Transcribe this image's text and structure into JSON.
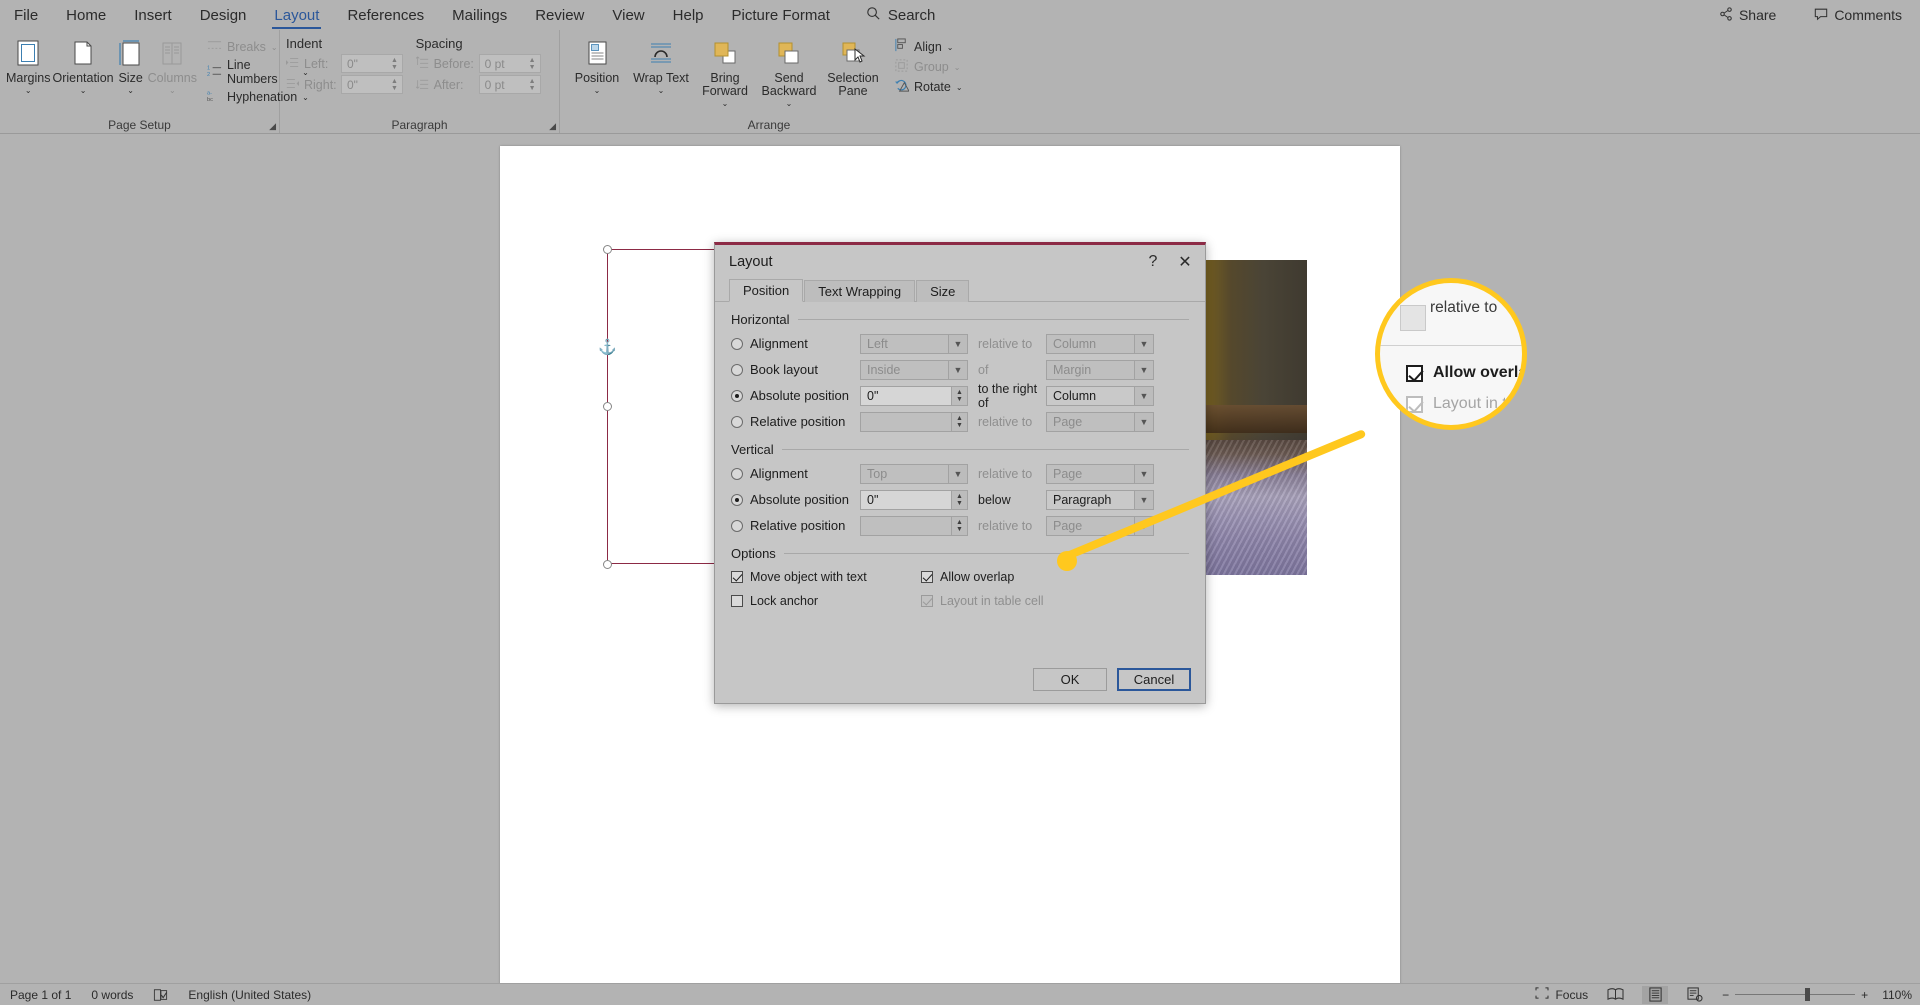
{
  "menubar": {
    "items": [
      {
        "label": "File",
        "active": false
      },
      {
        "label": "Home",
        "active": false
      },
      {
        "label": "Insert",
        "active": false
      },
      {
        "label": "Design",
        "active": false
      },
      {
        "label": "Layout",
        "active": true
      },
      {
        "label": "References",
        "active": false
      },
      {
        "label": "Mailings",
        "active": false
      },
      {
        "label": "Review",
        "active": false
      },
      {
        "label": "View",
        "active": false
      },
      {
        "label": "Help",
        "active": false
      },
      {
        "label": "Picture Format",
        "active": false
      }
    ],
    "search_label": "Search",
    "share_label": "Share",
    "comments_label": "Comments"
  },
  "ribbon": {
    "groups": [
      {
        "name": "Page Setup",
        "label": "Page Setup",
        "buttons": [
          {
            "label": "Margins",
            "caret": "⌄",
            "disabled": false
          },
          {
            "label": "Orientation",
            "caret": "⌄",
            "disabled": false
          },
          {
            "label": "Size",
            "caret": "⌄",
            "disabled": false
          },
          {
            "label": "Columns",
            "caret": "⌄",
            "disabled": true
          }
        ],
        "small_items": [
          {
            "label": "Breaks",
            "caret": "⌄",
            "disabled": true
          },
          {
            "label": "Line Numbers",
            "caret": "⌄",
            "disabled": false
          },
          {
            "label": "Hyphenation",
            "caret": "⌄",
            "disabled": false
          }
        ]
      },
      {
        "name": "Paragraph",
        "label": "Paragraph",
        "indent_label": "Indent",
        "spacing_label": "Spacing",
        "fields": [
          {
            "label": "Left:",
            "value": "0\"",
            "disabled": true
          },
          {
            "label": "Right:",
            "value": "0\"",
            "disabled": true
          },
          {
            "label": "Before:",
            "value": "0 pt",
            "disabled": true
          },
          {
            "label": "After:",
            "value": "0 pt",
            "disabled": true
          }
        ]
      },
      {
        "name": "Arrange",
        "label": "Arrange",
        "buttons": [
          {
            "label": "Position",
            "caret": "⌄",
            "disabled": false
          },
          {
            "label": "Wrap Text",
            "caret": "⌄",
            "disabled": false
          },
          {
            "label": "Bring Forward",
            "caret": "⌄",
            "disabled": false
          },
          {
            "label": "Send Backward",
            "caret": "⌄",
            "disabled": false
          },
          {
            "label": "Selection Pane",
            "caret": "",
            "disabled": false
          }
        ],
        "small_items": [
          {
            "label": "Align",
            "caret": "⌄",
            "disabled": false
          },
          {
            "label": "Group",
            "caret": "⌄",
            "disabled": true
          },
          {
            "label": "Rotate",
            "caret": "⌄",
            "disabled": false
          }
        ]
      }
    ]
  },
  "dialog": {
    "title": "Layout",
    "help_glyph": "?",
    "close_glyph": "✕",
    "tabs": [
      {
        "label": "Position",
        "active": true
      },
      {
        "label": "Text Wrapping",
        "active": false
      },
      {
        "label": "Size",
        "active": false
      }
    ],
    "horizontal": {
      "section_label": "Horizontal",
      "rows": [
        {
          "option": "Alignment",
          "option_u": "A",
          "selected": false,
          "value": "Left",
          "value_kind": "combo",
          "value_enabled": false,
          "mid": "relative to",
          "mid_u": "",
          "mid_enabled": false,
          "right": "Column",
          "right_enabled": false
        },
        {
          "option": "Book layout",
          "option_u": "B",
          "selected": false,
          "value": "Inside",
          "value_kind": "combo",
          "value_enabled": false,
          "mid": "of",
          "mid_u": "",
          "mid_enabled": false,
          "right": "Margin",
          "right_enabled": false
        },
        {
          "option": "Absolute position",
          "option_u": "s",
          "selected": true,
          "value": "0\"",
          "value_kind": "spin",
          "value_enabled": true,
          "mid": "to the right of",
          "mid_u": "t",
          "mid_enabled": true,
          "right": "Column",
          "right_enabled": true
        },
        {
          "option": "Relative position",
          "option_u": "R",
          "selected": false,
          "value": "",
          "value_kind": "spin",
          "value_enabled": false,
          "mid": "relative to",
          "mid_u": "",
          "mid_enabled": false,
          "right": "Page",
          "right_enabled": false
        }
      ]
    },
    "vertical": {
      "section_label": "Vertical",
      "rows": [
        {
          "option": "Alignment",
          "option_u": "g",
          "selected": false,
          "value": "Top",
          "value_kind": "combo",
          "value_enabled": false,
          "mid": "relative to",
          "mid_u": "",
          "mid_enabled": false,
          "right": "Page",
          "right_enabled": false
        },
        {
          "option": "Absolute position",
          "option_u": "s",
          "selected": true,
          "value": "0\"",
          "value_kind": "spin",
          "value_enabled": true,
          "mid": "below",
          "mid_u": "b",
          "mid_enabled": true,
          "right": "Paragraph",
          "right_enabled": true
        },
        {
          "option": "Relative position",
          "option_u": "v",
          "selected": false,
          "value": "",
          "value_kind": "spin",
          "value_enabled": false,
          "mid": "relative to",
          "mid_u": "",
          "mid_enabled": false,
          "right": "Page",
          "right_enabled": false
        }
      ]
    },
    "options": {
      "section_label": "Options",
      "left": [
        {
          "label": "Move object with text",
          "checked": true,
          "disabled": false
        },
        {
          "label": "Lock anchor",
          "checked": false,
          "disabled": false
        }
      ],
      "right": [
        {
          "label": "Allow overlap",
          "checked": true,
          "disabled": false
        },
        {
          "label": "Layout in table cell",
          "checked": true,
          "disabled": true
        }
      ]
    },
    "buttons": {
      "ok": "OK",
      "cancel": "Cancel"
    }
  },
  "callout": {
    "relative_to": "relative to",
    "allow_overlap": "Allow overlap",
    "layout_in_table": "Layout in table",
    "highlight_color": "#ffc81e"
  },
  "statusbar": {
    "page": "Page 1 of 1",
    "words": "0 words",
    "proofing_icon": "proofing-icon",
    "language": "English (United States)",
    "focus": "Focus",
    "zoom_minus": "−",
    "zoom_plus": "+",
    "zoom_level": "110%"
  }
}
